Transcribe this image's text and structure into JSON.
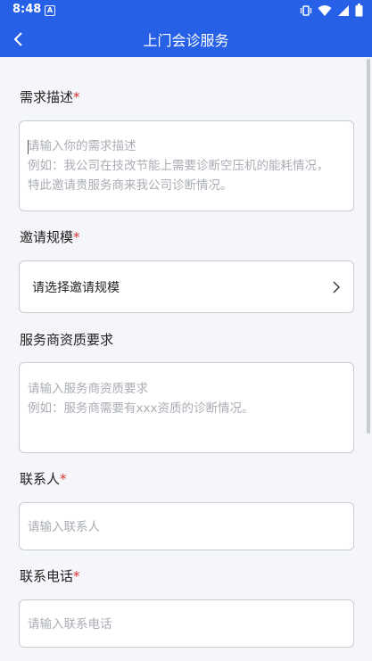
{
  "status_bar": {
    "time": "8:48"
  },
  "header": {
    "title": "上门会诊服务"
  },
  "form": {
    "demand": {
      "label": "需求描述",
      "required_mark": "*",
      "placeholder_line1": "请输入你的需求描述",
      "placeholder_line2": "例如：我公司在技改节能上需要诊断空压机的能耗情况，",
      "placeholder_line3": "特此邀请贵服务商来我公司诊断情况。"
    },
    "scale": {
      "label": "邀请规模",
      "required_mark": "*",
      "value": "请选择邀请规模"
    },
    "qualification": {
      "label": "服务商资质要求",
      "placeholder_line1": "请输入服务商资质要求",
      "placeholder_line2": "例如：服务商需要有xxx资质的诊断情况。"
    },
    "contact": {
      "label": "联系人",
      "required_mark": "*",
      "placeholder": "请输入联系人"
    },
    "phone": {
      "label": "联系电话",
      "required_mark": "*",
      "placeholder": "请输入联系电话"
    }
  }
}
